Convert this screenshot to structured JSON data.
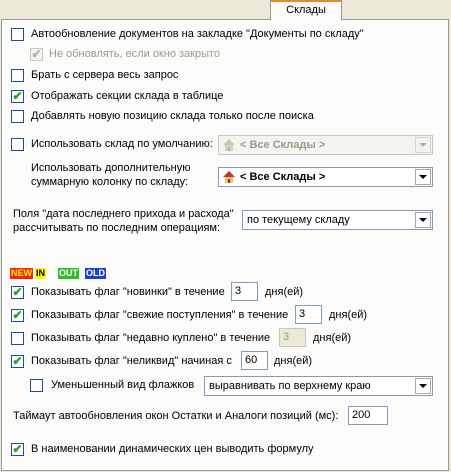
{
  "tab": {
    "label": "Склады"
  },
  "options": {
    "auto_update": {
      "label": "Автообновление документов на закладке \"Документы по складу\"",
      "checked": false
    },
    "no_update_closed": {
      "label": "Не обновлять, если окно закрыто",
      "checked": true,
      "disabled": true
    },
    "full_request": {
      "label": "Брать с сервера весь запрос",
      "checked": false
    },
    "show_sections": {
      "label": "Отображать секции склада в таблице",
      "checked": true
    },
    "add_after_search": {
      "label": "Добавлять новую позицию склада только после поиска",
      "checked": false
    },
    "default_warehouse": {
      "label": "Использовать склад по умолчанию:",
      "checked": false,
      "value": "< Все Склады >"
    },
    "extra_column": {
      "label_line1": "Использовать дополнительную",
      "label_line2": "суммарную колонку по складу:",
      "value": "< Все Склады >"
    },
    "date_fields": {
      "label_line1": "Поля \"дата последнего прихода и расхода\"",
      "label_line2": "рассчитывать по последним операциям:",
      "value": "по текущему складу"
    }
  },
  "flags_legend": [
    {
      "text": "NEW",
      "bg": "#ff1b1b",
      "color": "#ffff00"
    },
    {
      "text": "IN",
      "bg": "#ffff00",
      "color": "#000000"
    },
    {
      "text": "OUT",
      "bg": "#2bbf2b",
      "color": "#ffffff"
    },
    {
      "text": "OLD",
      "bg": "#1f3fd0",
      "color": "#ffffff"
    }
  ],
  "flag_rows": {
    "new": {
      "label": "Показывать флаг \"новинки\" в течение",
      "value": "3",
      "unit": "дня(ей)",
      "checked": true
    },
    "fresh": {
      "label": "Показывать флаг \"свежие поступления\" в течение",
      "value": "3",
      "unit": "дня(ей)",
      "checked": true
    },
    "recent": {
      "label": "Показывать флаг \"недавно куплено\" в течение",
      "value": "3",
      "unit": "дня(ей)",
      "checked": false
    },
    "illiquid": {
      "label": "Показывать флаг \"неликвид\" начиная с",
      "value": "60",
      "unit": "дня(ей)",
      "checked": true
    },
    "small_flags": {
      "label": "Уменьшенный вид флажков",
      "checked": false,
      "align_value": "выравнивать по верхнему краю"
    }
  },
  "timeout": {
    "label": "Таймаут автообновления окон Остатки и Аналоги позиций (мс):",
    "value": "200"
  },
  "formula": {
    "label": "В наименовании динамических цен выводить формулу",
    "checked": true
  },
  "colors": {
    "tab_accent": "#e68b2c",
    "check": "#21a121",
    "panel_bg": "#fbfbf9",
    "window_bg": "#ece9d8"
  }
}
